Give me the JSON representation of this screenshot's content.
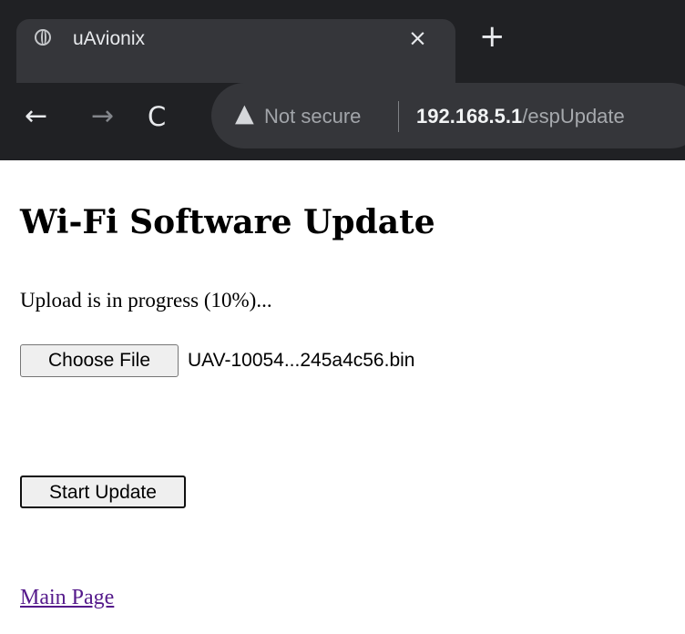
{
  "browser": {
    "tab": {
      "title": "uAvionix",
      "close_glyph": "×",
      "favicon": "globe-icon"
    },
    "new_tab_glyph": "+",
    "nav": {
      "back_glyph": "←",
      "forward_glyph": "→",
      "reload_glyph": "C"
    },
    "address_bar": {
      "security_label": "Not secure",
      "host": "192.168.5.1",
      "path": "/espUpdate",
      "warning_glyph": "▲"
    },
    "colors": {
      "chrome_background": "#202124",
      "tab_background": "#35363a",
      "omnibox_background": "#35363a"
    }
  },
  "page": {
    "title": "Wi-Fi Software Update",
    "status": "Upload is in progress (10%)...",
    "file_input": {
      "button_label": "Choose File",
      "selected_file": "UAV-10054...245a4c56.bin"
    },
    "start_update_label": "Start Update",
    "main_page_link": "Main Page",
    "colors": {
      "link": "#551a8b"
    }
  }
}
